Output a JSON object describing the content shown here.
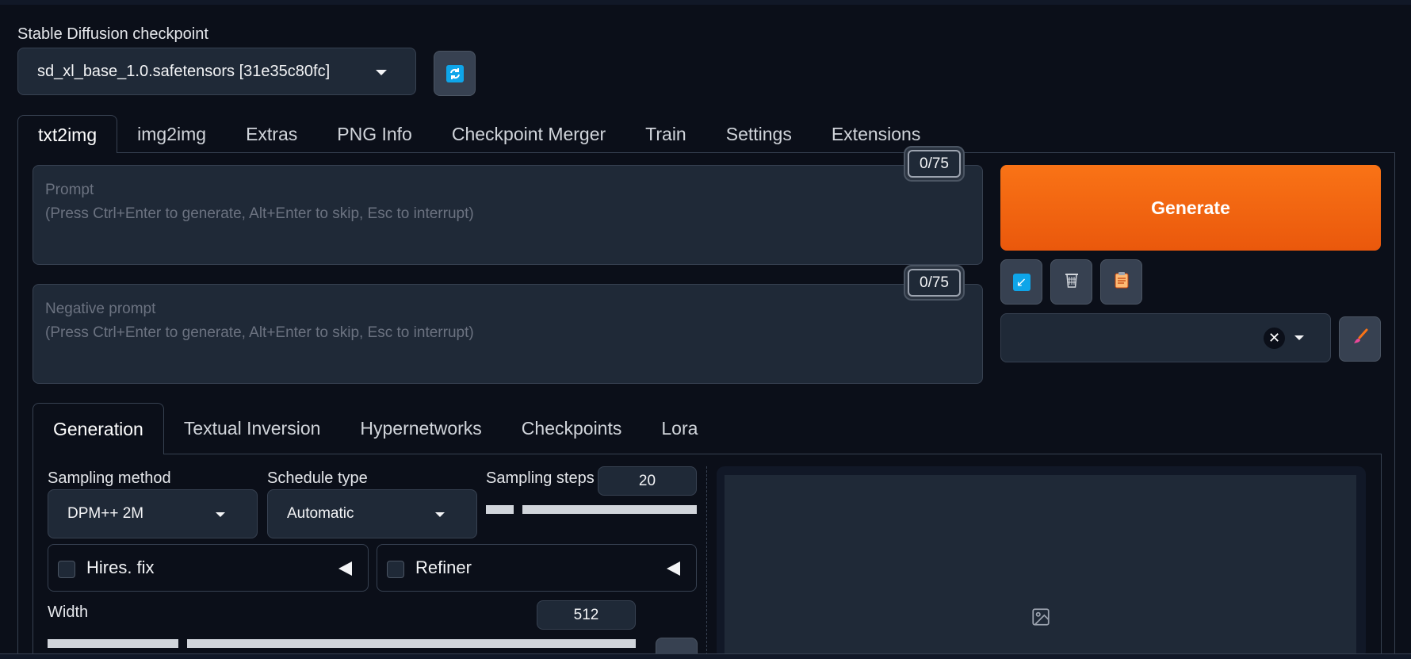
{
  "checkpoint": {
    "label": "Stable Diffusion checkpoint",
    "selected": "sd_xl_base_1.0.safetensors [31e35c80fc]"
  },
  "main_tabs": [
    "txt2img",
    "img2img",
    "Extras",
    "PNG Info",
    "Checkpoint Merger",
    "Train",
    "Settings",
    "Extensions"
  ],
  "prompt": {
    "placeholder": "Prompt\n(Press Ctrl+Enter to generate, Alt+Enter to skip, Esc to interrupt)",
    "token_count": "0/75"
  },
  "negative_prompt": {
    "placeholder": "Negative prompt\n(Press Ctrl+Enter to generate, Alt+Enter to skip, Esc to interrupt)",
    "token_count": "0/75"
  },
  "generate_label": "Generate",
  "tool_icons": [
    "read-params-icon",
    "trash-icon",
    "clipboard-icon",
    "brush-icon",
    "refresh-icon",
    "image-icon"
  ],
  "sub_tabs": [
    "Generation",
    "Textual Inversion",
    "Hypernetworks",
    "Checkpoints",
    "Lora"
  ],
  "generation": {
    "sampling_method_label": "Sampling method",
    "sampling_method": "DPM++ 2M",
    "schedule_type_label": "Schedule type",
    "schedule_type": "Automatic",
    "sampling_steps_label": "Sampling steps",
    "sampling_steps": "20",
    "hires_fix_label": "Hires. fix",
    "refiner_label": "Refiner",
    "width_label": "Width",
    "width": "512"
  },
  "colors": {
    "background": "#0b0f19",
    "panel": "#1f2937",
    "border": "#374151",
    "generate": "#f97316",
    "icon_blue": "#0ea5e9"
  }
}
